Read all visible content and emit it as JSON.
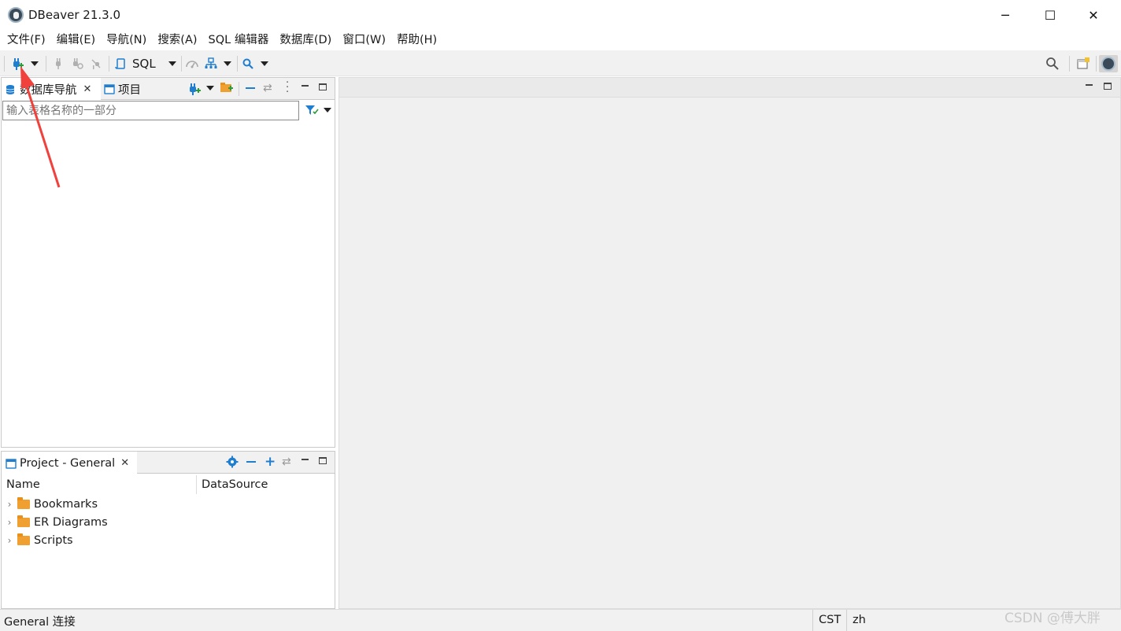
{
  "window": {
    "title": "DBeaver 21.3.0",
    "minimize": "─",
    "maximize": "☐",
    "close": "✕"
  },
  "menu": [
    "文件(F)",
    "编辑(E)",
    "导航(N)",
    "搜索(A)",
    "SQL 编辑器",
    "数据库(D)",
    "窗口(W)",
    "帮助(H)"
  ],
  "toolbar": {
    "new_connection_icon": "plug-plus-icon",
    "sql_label": "SQL"
  },
  "navigator": {
    "tabs": [
      {
        "label": "数据库导航",
        "icon": "database-nav-icon",
        "active": true
      },
      {
        "label": "项目",
        "icon": "project-icon",
        "active": false
      }
    ],
    "filter_placeholder": "输入表格名称的一部分"
  },
  "project_panel": {
    "tab_label": "Project - General",
    "columns": [
      "Name",
      "DataSource"
    ],
    "items": [
      {
        "label": "Bookmarks",
        "icon": "bookmarks-folder-icon"
      },
      {
        "label": "ER Diagrams",
        "icon": "er-diagrams-folder-icon"
      },
      {
        "label": "Scripts",
        "icon": "scripts-folder-icon"
      }
    ]
  },
  "status": {
    "left": "General 连接",
    "timezone": "CST",
    "locale": "zh"
  },
  "watermark": "CSDN @傅大胖",
  "colors": {
    "accent_blue": "#1f7ecf",
    "folder_orange": "#f0a030",
    "annotation_red": "#f0413c"
  }
}
